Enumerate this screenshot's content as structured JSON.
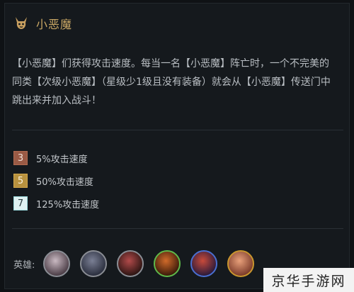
{
  "trait": {
    "name": "小恶魔",
    "icon": "imp-horns-icon",
    "description": "【小恶魔】们获得攻击速度。每当一名【小恶魔】阵亡时，一个不完美的同类【次级小恶魔】（星级少1级且没有装备）就会从【小恶魔】传送门中跳出来并加入战斗！"
  },
  "tiers": [
    {
      "count": "3",
      "label": "5%攻击速度",
      "bg": "#9a5a45",
      "fg": "#f0e0d8",
      "border": "#b06a50"
    },
    {
      "count": "5",
      "label": "50%攻击速度",
      "bg": "#b8923f",
      "fg": "#fbf2de",
      "border": "#d3a84b"
    },
    {
      "count": "7",
      "label": "125%攻击速度",
      "bg": "#dff2f2",
      "fg": "#2a3a3e",
      "border": "#9ad9dc"
    }
  ],
  "heroes": {
    "label": "英雄:",
    "champions": [
      {
        "icon": "champion-portrait-1-icon",
        "border": "#8a8d94",
        "c1": "#c9b9c2",
        "c2": "#4a3c45"
      },
      {
        "icon": "champion-portrait-2-icon",
        "border": "#8a8d94",
        "c1": "#7a7f94",
        "c2": "#2a2e3d"
      },
      {
        "icon": "champion-portrait-3-icon",
        "border": "#8a8d94",
        "c1": "#b14a4a",
        "c2": "#2b1412"
      },
      {
        "icon": "champion-portrait-4-icon",
        "border": "#5fb84a",
        "c1": "#d06a2a",
        "c2": "#3a1a0a"
      },
      {
        "icon": "champion-portrait-5-icon",
        "border": "#4a6fd0",
        "c1": "#c84a3a",
        "c2": "#2a1a3a"
      },
      {
        "icon": "champion-portrait-6-icon",
        "border": "#c9962e",
        "c1": "#e8a07a",
        "c2": "#7a3a2a"
      }
    ]
  },
  "watermark": "京华手游网"
}
